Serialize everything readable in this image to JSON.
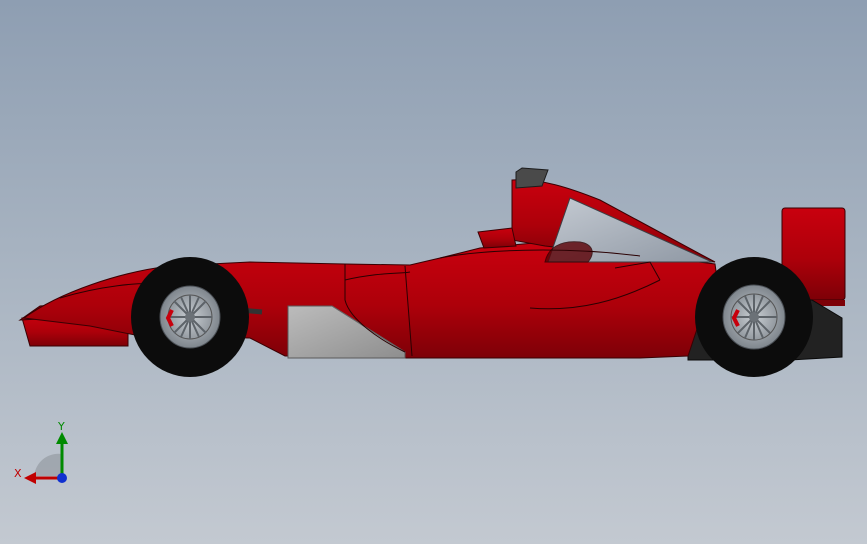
{
  "viewport": {
    "background_top": "#8e9eb2",
    "background_bottom": "#c3c9d1"
  },
  "model": {
    "body_color": "#b3000b",
    "body_dark": "#7a0008",
    "tire_color": "#0c0c0c",
    "rim_color": "#9aa0a6",
    "sidepod_panel_color": "#a9a9a9",
    "canopy_color": "#a6aeb8",
    "wing_color": "#c0000c"
  },
  "triad": {
    "x_label": "X",
    "y_label": "Y",
    "x_color": "#c00000",
    "y_color": "#008a00",
    "z_color": "#1030d0"
  }
}
